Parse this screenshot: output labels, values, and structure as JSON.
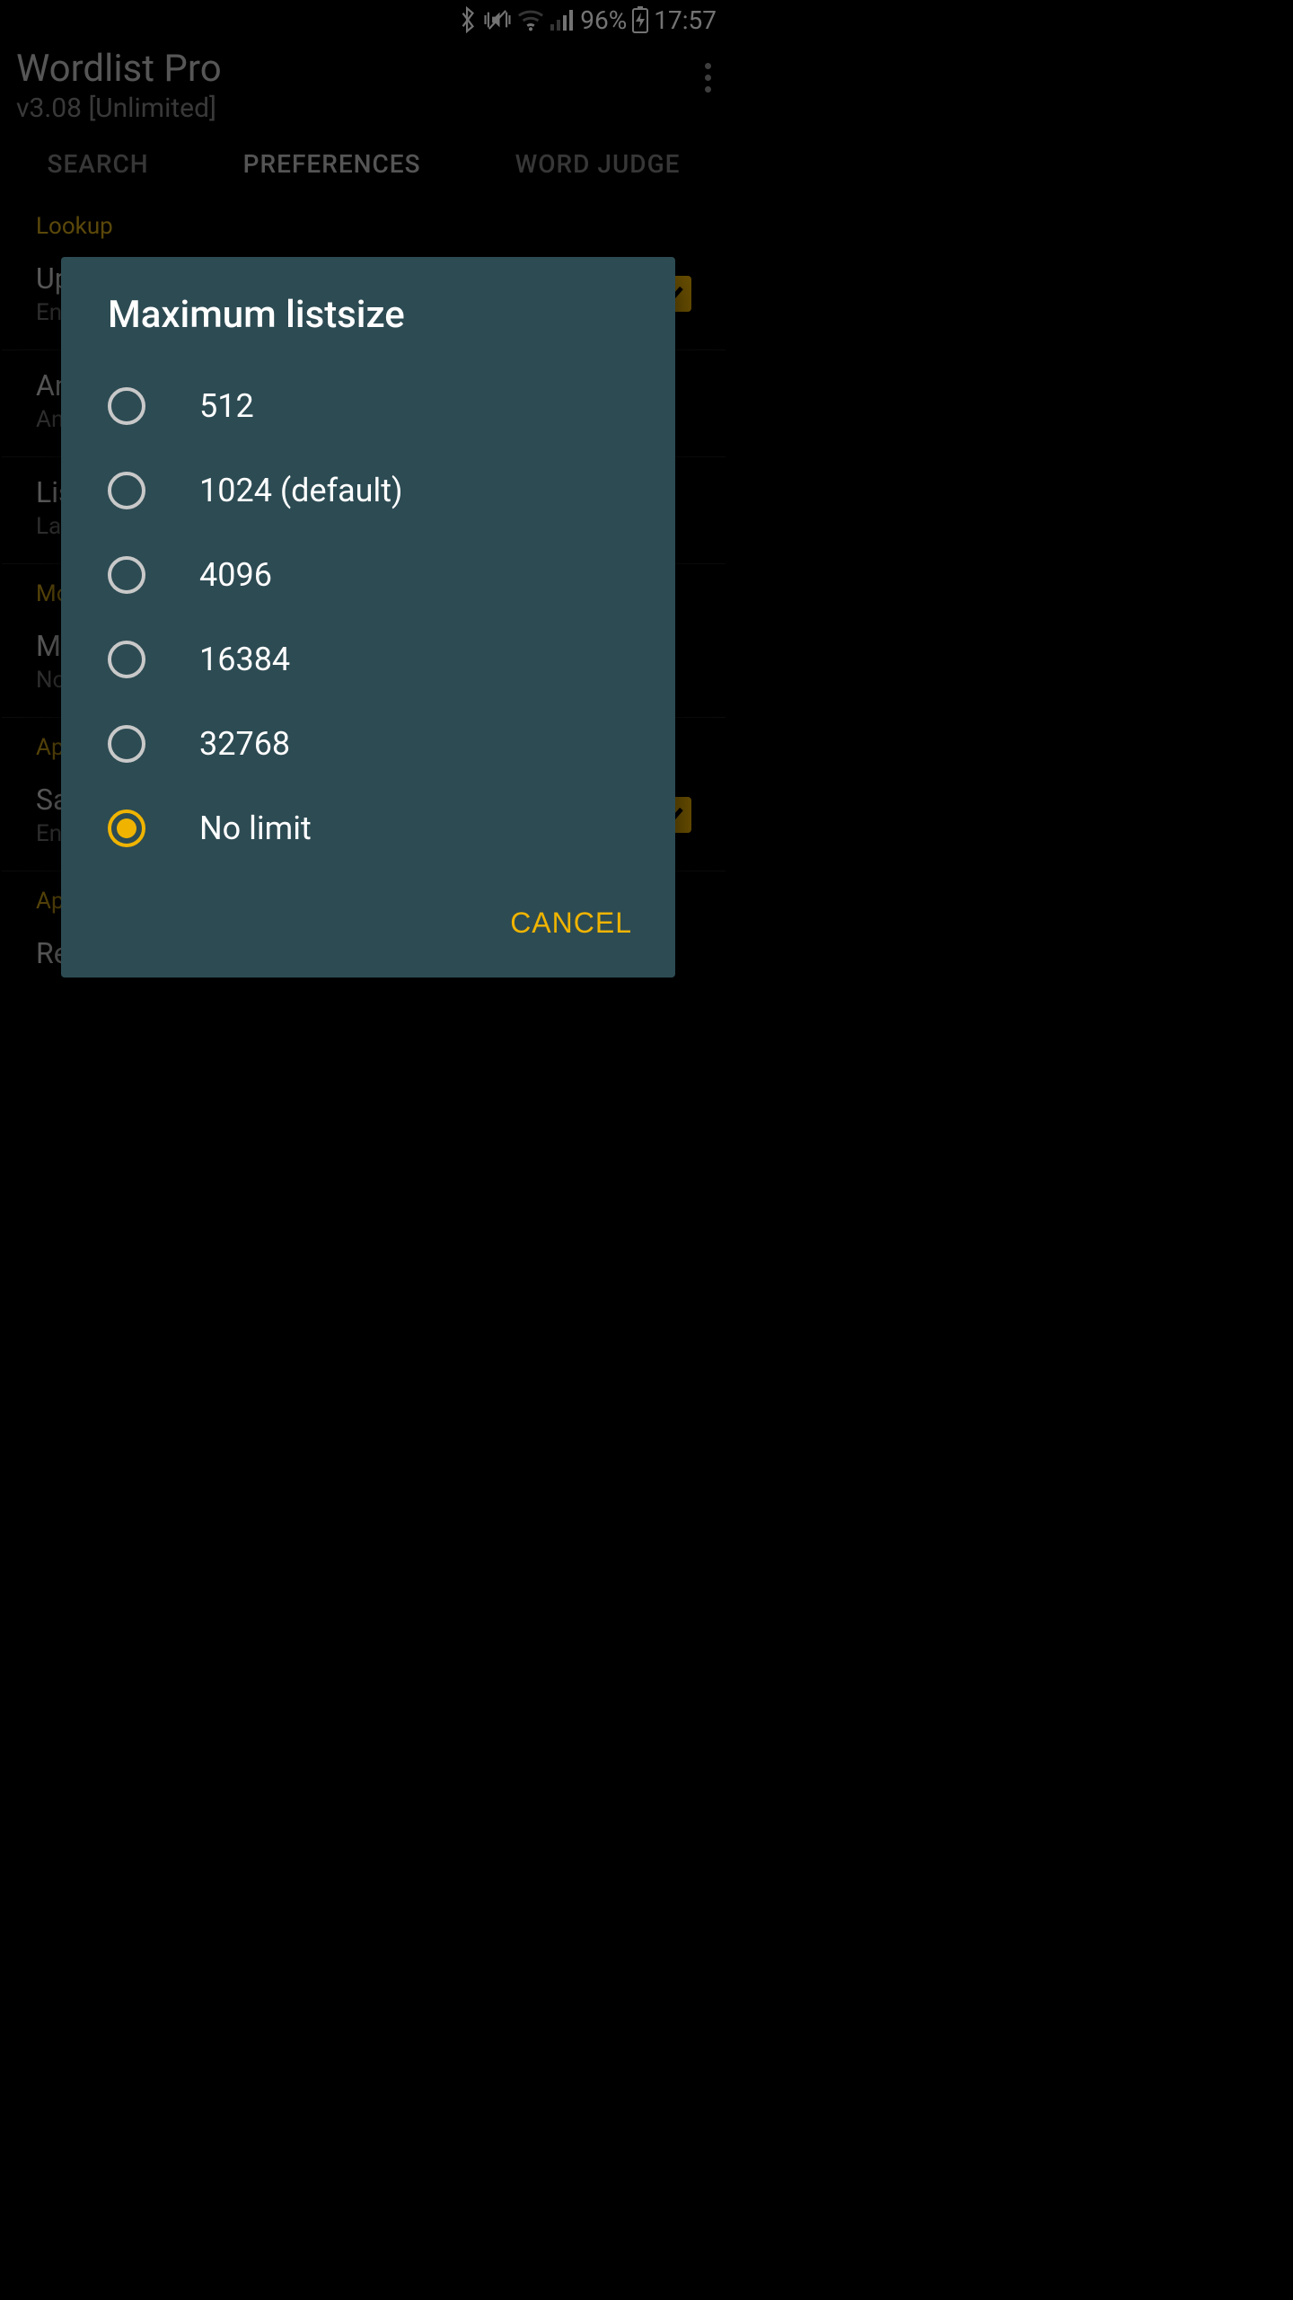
{
  "status": {
    "battery_pct": "96%",
    "clock": "17:57"
  },
  "header": {
    "title": "Wordlist Pro",
    "subtitle": "v3.08 [Unlimited]"
  },
  "tabs": {
    "search": "SEARCH",
    "preferences": "PREFERENCES",
    "word_judge": "WORD JUDGE"
  },
  "prefs": {
    "section_lookup": "Lookup",
    "row0": {
      "title": "Uppercase",
      "sub": "Enabled"
    },
    "row1": {
      "title": "Anagram",
      "sub": "Any"
    },
    "row2": {
      "title": "Listsize",
      "sub": "Large"
    },
    "section_more": "More",
    "row3": {
      "title": "Maximum listsize",
      "sub": "No limit"
    },
    "section_app": "App",
    "row4": {
      "title": "Save",
      "sub": "Enabled"
    },
    "section_app_options": "App options",
    "row5": {
      "title": "Reinstall wordlists",
      "sub": ""
    }
  },
  "dialog": {
    "title": "Maximum listsize",
    "options": {
      "o0": "512",
      "o1": "1024 (default)",
      "o2": "4096",
      "o3": "16384",
      "o4": "32768",
      "o5": "No limit"
    },
    "selected_index": 5,
    "cancel": "CANCEL"
  },
  "colors": {
    "accent": "#f0b400",
    "dialog_bg": "#2d4b53"
  }
}
